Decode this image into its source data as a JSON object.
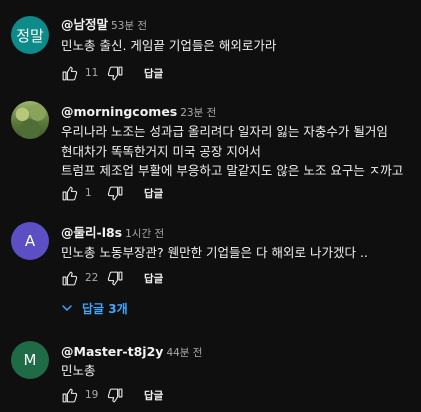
{
  "comments": [
    {
      "avatar_text": "정말",
      "avatar_color": "#0d8a8a",
      "author": "@남정말",
      "time": "53분 전",
      "lines": [
        "민노총 출신. 게임끝 기업들은 해외로가라"
      ],
      "likes": "11",
      "reply_label": "답글"
    },
    {
      "avatar_text": "",
      "avatar_color": "#6d8a4a",
      "author": "@morningcomes",
      "time": "23분 전",
      "lines": [
        "우리나라 노조는 성과급 올리려다 일자리 잃는 자충수가 될거임",
        "현대차가 똑똑한거지 미국 공장 지어서",
        "트럼프 제조업 부활에 부응하고 말같지도 않은 노조 요구는 ㅈ까고"
      ],
      "likes": "1",
      "reply_label": "답글"
    },
    {
      "avatar_text": "A",
      "avatar_color": "#5c4fc4",
      "author": "@둘리-l8s",
      "time": "1시간 전",
      "lines": [
        "민노총 노동부장관? 웬만한 기업들은 다 해외로 나가겠다 .."
      ],
      "likes": "22",
      "reply_label": "답글",
      "replies_label": "답글 3개"
    },
    {
      "avatar_text": "M",
      "avatar_color": "#1e6b46",
      "author": "@Master-t8j2y",
      "time": "44분 전",
      "lines": [
        "민노총"
      ],
      "likes": "19",
      "reply_label": "답글"
    }
  ],
  "colors": {
    "background": "#0f0f0f",
    "text": "#f1f1f1",
    "muted": "#aaaaaa",
    "link": "#3ea6ff"
  },
  "icons": [
    "thumbs-up-icon",
    "thumbs-down-icon",
    "chevron-down-icon"
  ]
}
